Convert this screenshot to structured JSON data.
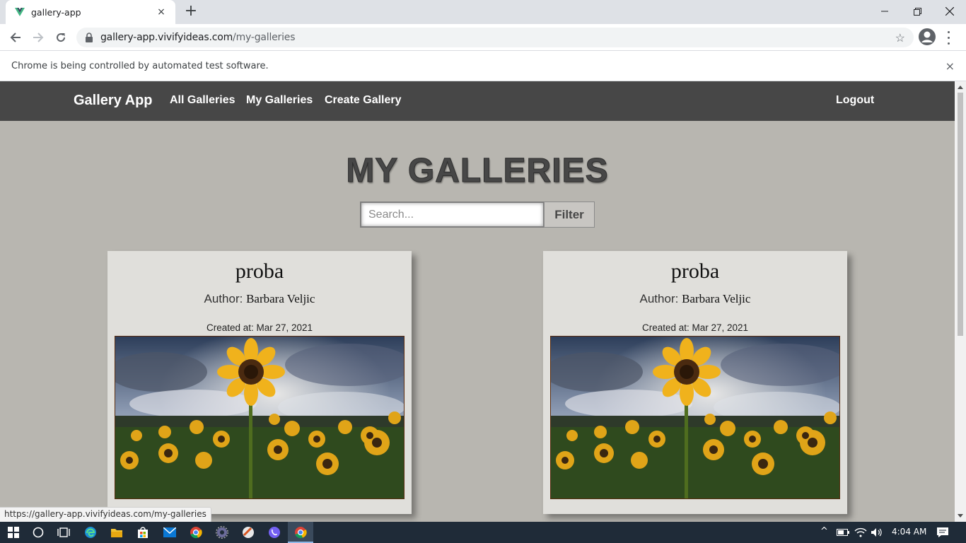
{
  "browser": {
    "tab_title": "gallery-app",
    "tab_close": "×",
    "new_tab": "+",
    "url_host": "gallery-app.vivifyideas.com",
    "url_path": "/my-galleries",
    "infobar_text": "Chrome is being controlled by automated test software.",
    "infobar_close": "×",
    "status_url": "https://gallery-app.vivifyideas.com/my-galleries"
  },
  "app": {
    "brand": "Gallery App",
    "nav": {
      "all_galleries": "All Galleries",
      "my_galleries": "My Galleries",
      "create_gallery": "Create Gallery",
      "logout": "Logout"
    },
    "page_title": "MY GALLERIES",
    "search": {
      "placeholder": "Search...",
      "value": ""
    },
    "filter_label": "Filter",
    "galleries": [
      {
        "title": "proba",
        "author_label": "Author:",
        "author_name": "Barbara Veljic",
        "created": "Created at: Mar 27, 2021",
        "image": "sunflower-field"
      },
      {
        "title": "proba",
        "author_label": "Author:",
        "author_name": "Barbara Veljic",
        "created": "Created at: Mar 27, 2021",
        "image": "sunflower-field"
      }
    ]
  },
  "taskbar": {
    "time": "4:04 AM"
  },
  "colors": {
    "navbar": "#474747",
    "page_bg": "#b8b6b0",
    "card_bg": "#e0dfdb",
    "title": "#474747"
  }
}
